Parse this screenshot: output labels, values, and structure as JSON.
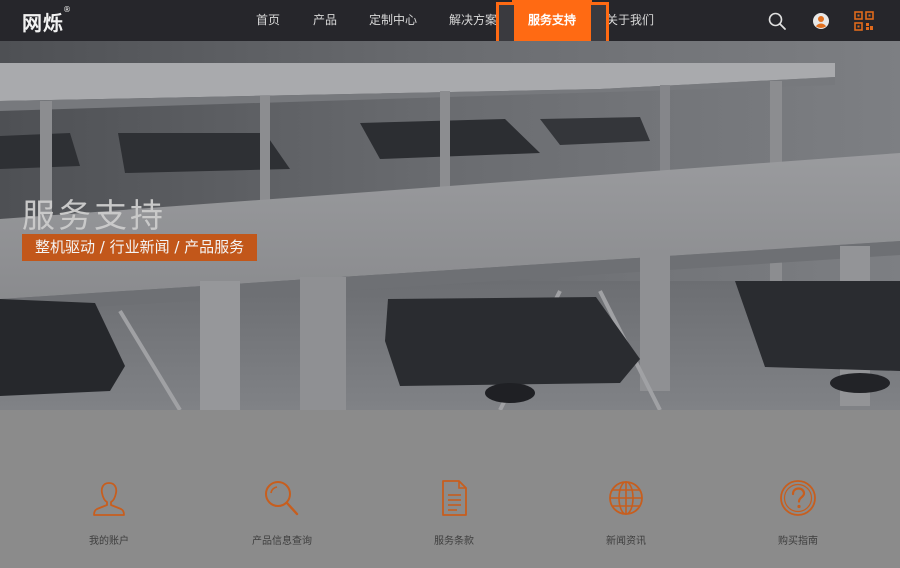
{
  "brand": {
    "name": "网烁",
    "reg_mark": "®",
    "accent_color": "#ff6a13"
  },
  "nav": {
    "items": [
      {
        "label": "首页"
      },
      {
        "label": "产品"
      },
      {
        "label": "定制中心"
      },
      {
        "label": "解决方案"
      },
      {
        "label": "服务支持",
        "active": true
      },
      {
        "label": "关于我们"
      }
    ],
    "icons": [
      "search-icon",
      "user-icon",
      "qr-code-icon"
    ]
  },
  "hero": {
    "title": "服务支持",
    "subtitle": "整机驱动 / 行业新闻 / 产品服务"
  },
  "services": [
    {
      "label": "我的账户",
      "icon": "user-outline-icon"
    },
    {
      "label": "产品信息查询",
      "icon": "magnifier-icon"
    },
    {
      "label": "服务条款",
      "icon": "document-icon"
    },
    {
      "label": "新闻资讯",
      "icon": "globe-icon"
    },
    {
      "label": "购买指南",
      "icon": "help-icon"
    }
  ]
}
